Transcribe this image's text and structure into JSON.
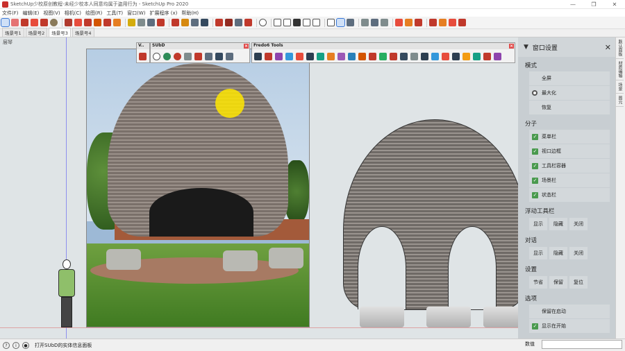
{
  "window": {
    "title": "SketchUp少校原创教程-未经少校本人同意均属于盗用行为 - SketchUp Pro 2020",
    "controls": [
      "—",
      "❐",
      "✕"
    ]
  },
  "menu": [
    "文件(F)",
    "编辑(E)",
    "视图(V)",
    "相机(C)",
    "绘图(R)",
    "工具(T)",
    "窗口(W)",
    "扩展程序 (x)",
    "帮助(H)"
  ],
  "scenes": {
    "tabs": [
      "场景号1",
      "场景号2",
      "场景号3",
      "场景号4"
    ],
    "active_index": 2,
    "viewport_label": "层琴"
  },
  "floating_toolbars": {
    "small": {
      "title": "V.."
    },
    "subd": {
      "title": "SUbD"
    },
    "fredo": {
      "title": "Fredo6 Tools"
    }
  },
  "panel": {
    "title": "窗口设置",
    "sections": {
      "mode": {
        "label": "模式",
        "items": [
          "全屏",
          "最大化",
          "恢复"
        ],
        "selected": "最大化"
      },
      "components": {
        "label": "分子",
        "items": [
          "菜单栏",
          "视口边框",
          "工具栏容器",
          "场景栏",
          "状态栏"
        ]
      },
      "floating": {
        "label": "浮动工具栏",
        "buttons": [
          "显示",
          "隐藏",
          "关闭"
        ]
      },
      "dialogs": {
        "label": "对话",
        "buttons": [
          "显示",
          "隐藏",
          "关闭"
        ]
      },
      "settings": {
        "label": "设置",
        "buttons": [
          "节省",
          "保留",
          "复位"
        ]
      },
      "options": {
        "label": "选项",
        "items": [
          "保留在启动",
          "显示在开始"
        ]
      }
    }
  },
  "vtabs": [
    "默认面板",
    "材质编辑",
    "场景",
    "图元"
  ],
  "status": {
    "message": "打开SUbD的实体信息面板",
    "measure_label": "数值"
  },
  "colors": {
    "accent": "#3a78d6",
    "check": "#4a9a4e",
    "highlight": "#ffe600"
  }
}
